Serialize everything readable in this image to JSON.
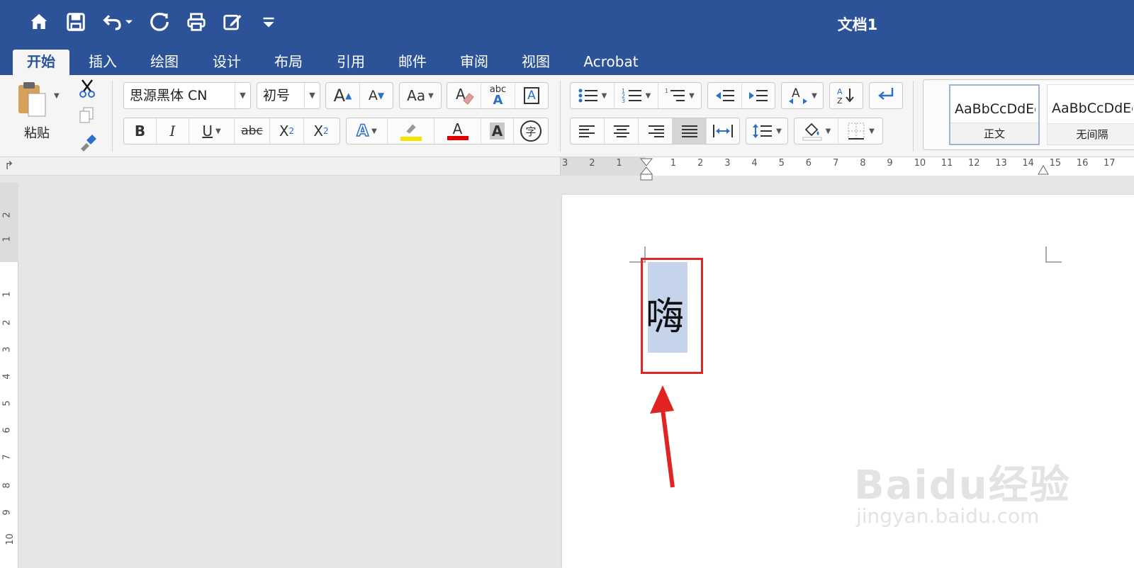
{
  "title_bar": {
    "document_title": "文档1",
    "quick_access": [
      {
        "name": "home-icon"
      },
      {
        "name": "save-icon"
      },
      {
        "name": "undo-icon"
      },
      {
        "name": "redo-icon"
      },
      {
        "name": "print-icon"
      },
      {
        "name": "edit-document-icon"
      },
      {
        "name": "customize-qat-icon"
      }
    ]
  },
  "tabs": [
    {
      "label": "开始",
      "active": true
    },
    {
      "label": "插入"
    },
    {
      "label": "绘图"
    },
    {
      "label": "设计"
    },
    {
      "label": "布局"
    },
    {
      "label": "引用"
    },
    {
      "label": "邮件"
    },
    {
      "label": "审阅"
    },
    {
      "label": "视图"
    },
    {
      "label": "Acrobat"
    }
  ],
  "ribbon": {
    "clipboard": {
      "paste_label": "粘贴"
    },
    "font": {
      "font_name": "思源黑体 CN",
      "font_size": "初号",
      "bold": "B",
      "italic": "I",
      "underline": "U",
      "strikethrough": "abc",
      "subscript_base": "X",
      "subscript_mark": "2",
      "superscript_base": "X",
      "superscript_mark": "2",
      "grow": "A",
      "shrink": "A",
      "change_case": "Aa",
      "spelling": "abc",
      "text_effects": "A",
      "font_color": "A",
      "char_shading": "A",
      "enclose_char": "字",
      "bordered_a": "A"
    },
    "styles": [
      {
        "sample": "AaBbCcDdEe",
        "name": "正文",
        "selected": true
      },
      {
        "sample": "AaBbCcDdEe",
        "name": "无间隔"
      }
    ],
    "colors": {
      "highlight": "#f5e400",
      "font_color": "#e00000"
    }
  },
  "rulers": {
    "horizontal": [
      "3",
      "2",
      "1",
      "1",
      "2",
      "3",
      "4",
      "5",
      "6",
      "7",
      "8",
      "9",
      "10",
      "11",
      "12",
      "13",
      "14",
      "15",
      "16",
      "17"
    ],
    "vertical": [
      "2",
      "1",
      "1",
      "2",
      "3",
      "4",
      "5",
      "6",
      "7",
      "8",
      "9",
      "10"
    ]
  },
  "document": {
    "selected_text": "嗨",
    "selection_color": "#c5d4ea",
    "annotation_color": "#d82a2a"
  },
  "watermark": {
    "logo": "Baidu经验",
    "url": "jingyan.baidu.com"
  }
}
